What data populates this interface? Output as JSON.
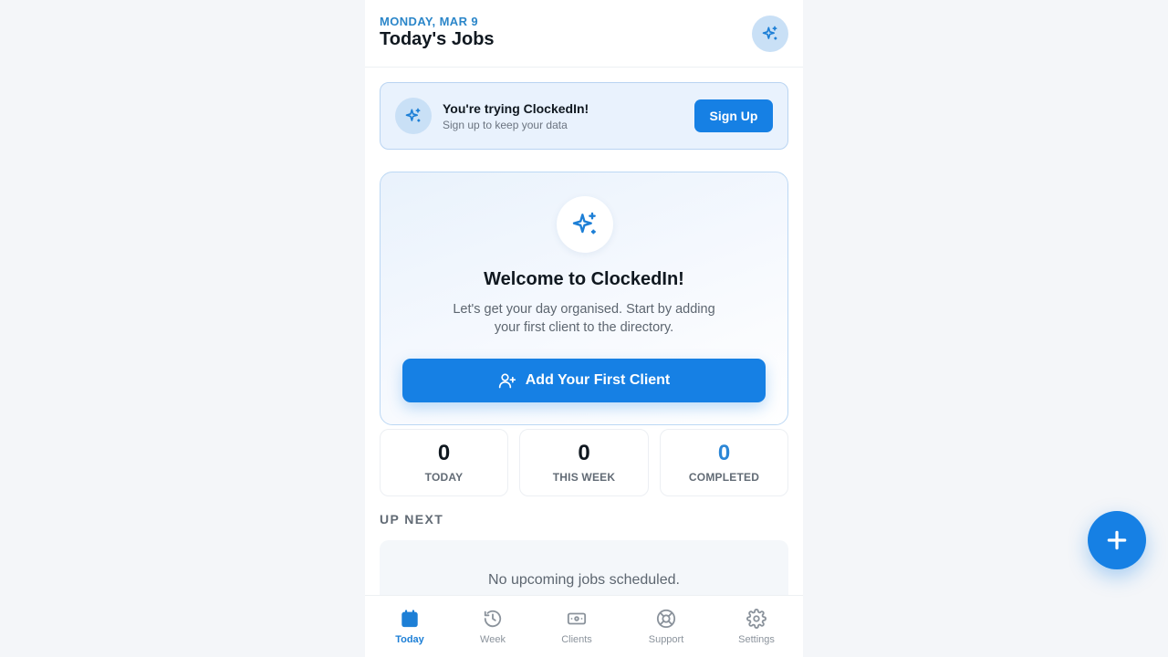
{
  "header": {
    "date": "MONDAY, MAR 9",
    "title": "Today's Jobs",
    "action_icon": "sparkles-icon"
  },
  "trial_banner": {
    "title": "You're trying ClockedIn!",
    "subtitle": "Sign up to keep your data",
    "button_label": "Sign Up"
  },
  "welcome": {
    "title": "Welcome to ClockedIn!",
    "description": "Let's get your day organised. Start by adding your first client to the directory.",
    "button_label": "Add Your First Client"
  },
  "stats": [
    {
      "value": "0",
      "label": "TODAY"
    },
    {
      "value": "0",
      "label": "THIS WEEK"
    },
    {
      "value": "0",
      "label": "COMPLETED"
    }
  ],
  "up_next": {
    "title": "UP NEXT",
    "empty_text": "No upcoming jobs scheduled."
  },
  "nav": [
    {
      "label": "Today",
      "icon": "calendar-icon",
      "active": true
    },
    {
      "label": "Week",
      "icon": "history-icon",
      "active": false
    },
    {
      "label": "Clients",
      "icon": "banknote-icon",
      "active": false
    },
    {
      "label": "Support",
      "icon": "lifebuoy-icon",
      "active": false
    },
    {
      "label": "Settings",
      "icon": "gear-icon",
      "active": false
    }
  ],
  "colors": {
    "primary": "#1680e4",
    "accent_text": "#2b86c9",
    "page_background": "#f4f6f9"
  }
}
